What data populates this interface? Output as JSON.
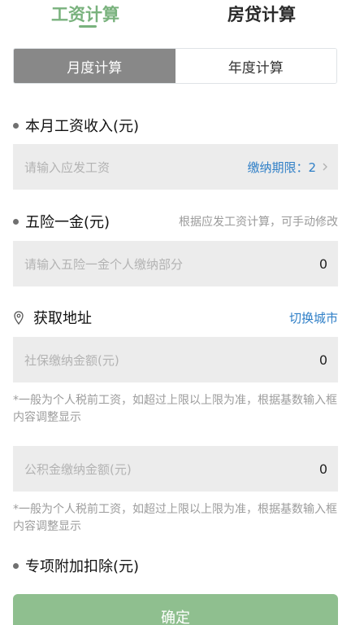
{
  "top_tabs": {
    "salary": "工资计算",
    "mortgage": "房贷计算"
  },
  "period_tabs": {
    "monthly": "月度计算",
    "yearly": "年度计算"
  },
  "income": {
    "title": "本月工资收入(元)",
    "placeholder": "请输入应发工资",
    "period_label": "缴纳期限：2"
  },
  "insurance": {
    "title": "五险一金(元)",
    "hint": "根据应发工资计算，可手动修改",
    "placeholder": "请输入五险一金个人缴纳部分",
    "value": "0"
  },
  "location": {
    "title": "获取地址",
    "switch_city": "切换城市"
  },
  "social_security": {
    "placeholder": "社保缴纳金额(元)",
    "value": "0",
    "note": "*一般为个人税前工资，如超过上限以上限为准，根据基数输入框内容调整显示"
  },
  "housing_fund": {
    "placeholder": "公积金缴纳金额(元)",
    "value": "0",
    "note": "*一般为个人税前工资，如超过上限以上限为准，根据基数输入框内容调整显示"
  },
  "special_deduction": {
    "title": "专项附加扣除(元)"
  },
  "confirm_button": "确定",
  "colors": {
    "accent_green": "#79b27d",
    "link_blue": "#2f7fc7",
    "button_green": "#8fbf8f"
  },
  "icons": {
    "location": "location-pin-icon",
    "chevron": "chevron-right-icon"
  }
}
